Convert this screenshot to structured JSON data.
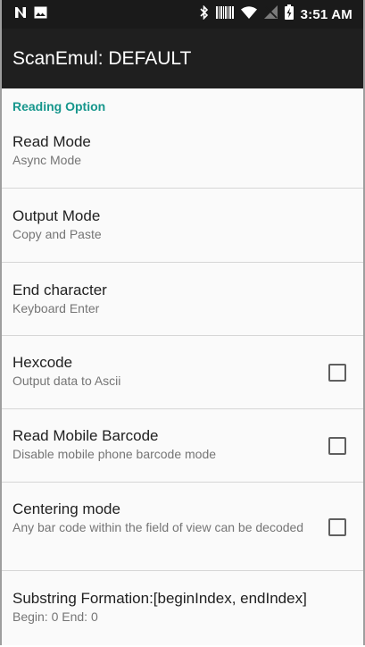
{
  "status_bar": {
    "time": "3:51 AM",
    "icons": [
      "notification-n-icon",
      "image-icon",
      "bluetooth-icon",
      "barcode-icon",
      "wifi-icon",
      "no-sim-icon",
      "battery-charging-icon"
    ]
  },
  "app_bar": {
    "title": "ScanEmul: DEFAULT"
  },
  "category": {
    "label": "Reading Option"
  },
  "preferences": [
    {
      "title": "Read Mode",
      "summary": "Async Mode"
    },
    {
      "title": "Output Mode",
      "summary": "Copy and Paste"
    },
    {
      "title": "End character",
      "summary": "Keyboard Enter"
    },
    {
      "title": "Hexcode",
      "summary": "Output data to Ascii",
      "checked": false
    },
    {
      "title": "Read Mobile Barcode",
      "summary": "Disable mobile phone barcode mode",
      "checked": false
    },
    {
      "title": "Centering mode",
      "summary": "Any bar code within the field of view can be decoded",
      "checked": false
    },
    {
      "title": "Substring Formation:[beginIndex, endIndex]",
      "summary": "Begin: 0 End: 0"
    }
  ],
  "colors": {
    "accent": "#16968c",
    "app_bar": "#1f1f1f",
    "status_bar": "#1a1a1a"
  }
}
